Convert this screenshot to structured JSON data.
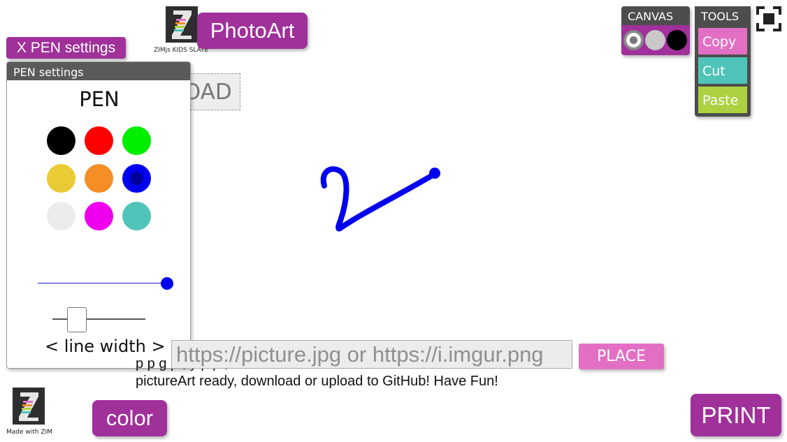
{
  "header": {
    "logo_caption": "ZIMjs KIDS SLATE",
    "app_button": "PhotoArt",
    "pen_settings_toggle": "X PEN settings"
  },
  "pen_panel": {
    "title": "PEN settings",
    "heading": "PEN",
    "swatches": [
      {
        "name": "black",
        "color": "#000000",
        "selected": false
      },
      {
        "name": "red",
        "color": "#ff0000",
        "selected": false
      },
      {
        "name": "green",
        "color": "#00ee00",
        "selected": false
      },
      {
        "name": "yellow",
        "color": "#ebcb35",
        "selected": false
      },
      {
        "name": "orange",
        "color": "#f58e25",
        "selected": false
      },
      {
        "name": "blue",
        "color": "#0000ee",
        "selected": true
      },
      {
        "name": "light-grey",
        "color": "#ececec",
        "selected": false
      },
      {
        "name": "magenta",
        "color": "#ee00ee",
        "selected": false
      },
      {
        "name": "teal",
        "color": "#50c4b8",
        "selected": false
      }
    ],
    "color_slider_level": 1.0,
    "line_width_level": 0.26,
    "line_width_label": "< line width >"
  },
  "upload_button": "UPLOAD",
  "canvas_widget": {
    "title": "CANVAS",
    "options": [
      {
        "name": "white",
        "color": "#ffffff",
        "selected": true
      },
      {
        "name": "grey",
        "color": "#c8c8c8",
        "selected": false
      },
      {
        "name": "black",
        "color": "#000000",
        "selected": false
      }
    ]
  },
  "tools_widget": {
    "title": "TOOLS",
    "buttons": [
      {
        "label": "Copy",
        "color": "#e36fc4"
      },
      {
        "label": "Cut",
        "color": "#50c4b8"
      },
      {
        "label": "Paste",
        "color": "#acd241"
      }
    ]
  },
  "fullscreen_icon": "fullscreen-icon",
  "drawing": {
    "stroke_color": "#0000ee"
  },
  "url_bar": {
    "placeholder": "https://picture.jpg or https://i.imgur.png",
    "place_button": "PLACE"
  },
  "instructions": {
    "line1": "p     p                g        p ,           y p        p ,",
    "line2": "pictureArt ready, download or upload to GitHub! Have Fun!"
  },
  "footer": {
    "logo_caption": "Made with ZIM",
    "color_button": "color",
    "print_button": "PRINT"
  },
  "colors": {
    "brand_purple": "#a0309a",
    "panel_header": "#5a5a5a"
  }
}
